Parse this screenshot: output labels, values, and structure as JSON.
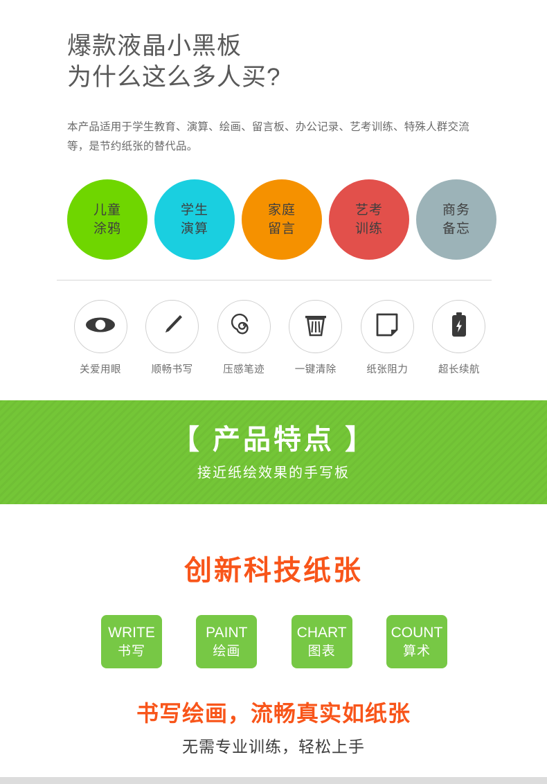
{
  "header": {
    "title_line1": "爆款液晶小黑板",
    "title_line2": "为什么这么多人买?",
    "intro": "本产品适用于学生教育、演算、绘画、留言板、办公记录、艺考训练、特殊人群交流等，是节约纸张的替代品。"
  },
  "use_cases": {
    "items": [
      {
        "line1": "儿童",
        "line2": "涂鸦",
        "color": "#6FD600"
      },
      {
        "line1": "学生",
        "line2": "演算",
        "color": "#1ACFE0"
      },
      {
        "line1": "家庭",
        "line2": "留言",
        "color": "#F59100"
      },
      {
        "line1": "艺考",
        "line2": "训练",
        "color": "#E2504B"
      },
      {
        "line1": "商务",
        "line2": "备忘",
        "color": "#9CB3B8"
      }
    ]
  },
  "features": {
    "items": [
      {
        "icon": "eye-icon",
        "label": "关爱用眼"
      },
      {
        "icon": "pen-icon",
        "label": "顺畅书写"
      },
      {
        "icon": "spiral-icon",
        "label": "压感笔迹"
      },
      {
        "icon": "trash-icon",
        "label": "一键清除"
      },
      {
        "icon": "paper-icon",
        "label": "纸张阻力"
      },
      {
        "icon": "battery-icon",
        "label": "超长续航"
      }
    ]
  },
  "banner": {
    "title": "【 产品特点 】",
    "subtitle": "接近纸绘效果的手写板",
    "background_color": "#74C637"
  },
  "innovation": {
    "heading": "创新科技纸张",
    "heading_color": "#F8551A",
    "tags": [
      {
        "en": "WRITE",
        "cn": "书写"
      },
      {
        "en": "PAINT",
        "cn": "绘画"
      },
      {
        "en": "CHART",
        "cn": "图表"
      },
      {
        "en": "COUNT",
        "cn": "算术"
      }
    ],
    "tag_color": "#77C845"
  },
  "footer": {
    "headline": "书写绘画，流畅真实如纸张",
    "subline": "无需专业训练，轻松上手"
  }
}
